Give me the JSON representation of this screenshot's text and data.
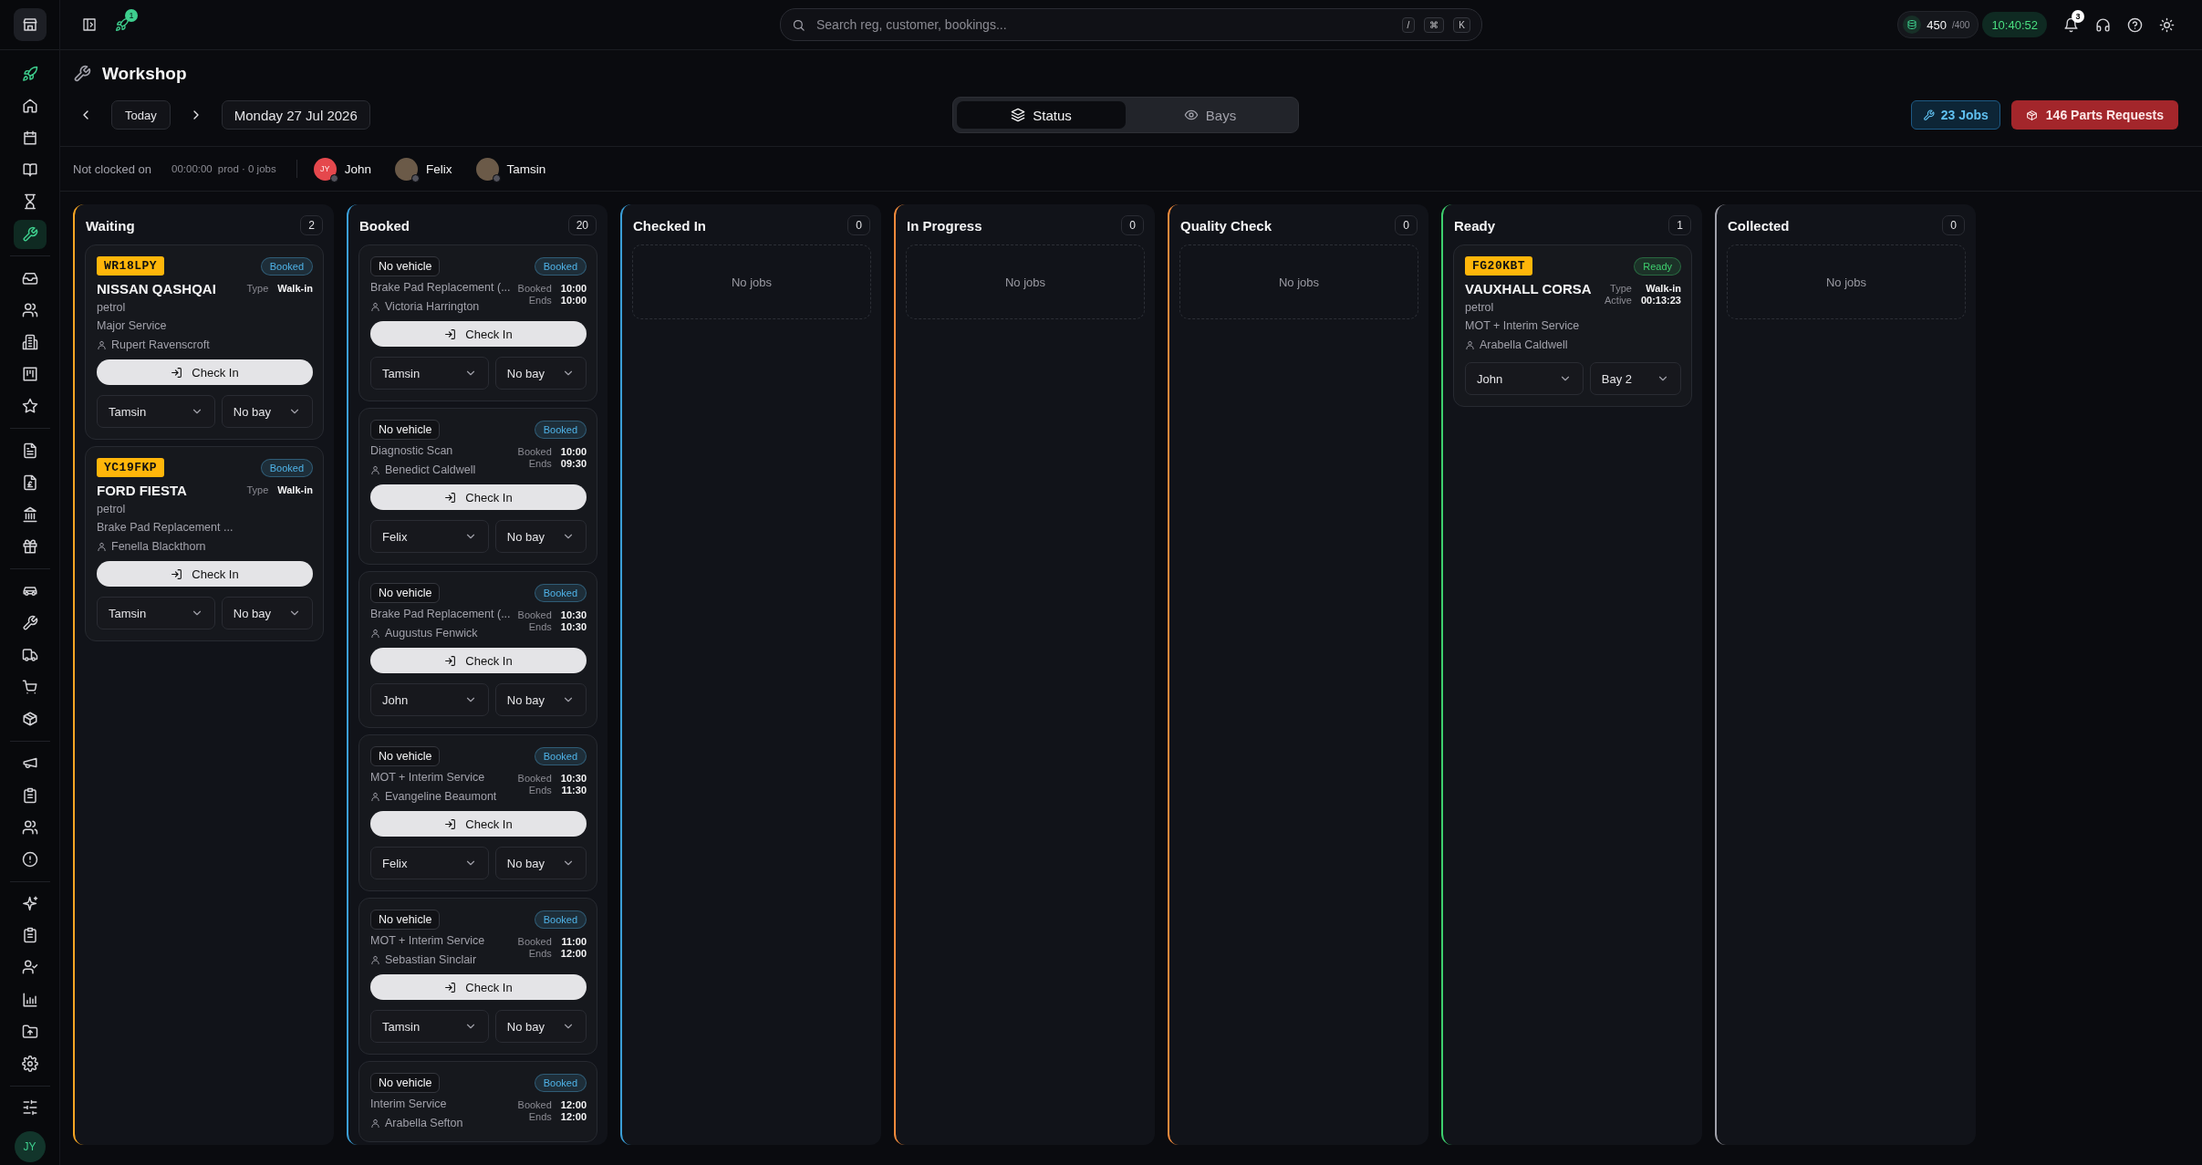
{
  "sidebar": {
    "groups": [
      [
        {
          "selected": false
        },
        {
          "selected": false
        },
        {
          "selected": false
        },
        {
          "selected": false
        },
        {
          "selected": false
        },
        {
          "selected": true
        }
      ],
      [
        {
          "selected": false
        },
        {
          "selected": false
        },
        {
          "selected": false
        },
        {
          "selected": false
        },
        {
          "selected": false
        }
      ],
      [
        {
          "selected": false
        },
        {
          "selected": false
        },
        {
          "selected": false
        },
        {
          "selected": false
        }
      ],
      [
        {
          "selected": false
        },
        {
          "selected": false
        },
        {
          "selected": false
        },
        {
          "selected": false
        },
        {
          "selected": false
        }
      ],
      [
        {
          "selected": false
        },
        {
          "selected": false
        },
        {
          "selected": false
        },
        {
          "selected": false
        }
      ],
      [
        {
          "selected": false
        },
        {
          "selected": false
        },
        {
          "selected": false
        },
        {
          "selected": false
        },
        {
          "selected": false
        },
        {
          "selected": false
        }
      ],
      [
        {
          "selected": false
        }
      ]
    ],
    "user_initials": "JY"
  },
  "top_bar": {
    "launch_badge": "1",
    "search": {
      "placeholder": "Search reg, customer, bookings...",
      "keys": [
        "/",
        "⌘",
        "K"
      ]
    },
    "credits": {
      "value": "450",
      "limit": "/400"
    },
    "clock": "10:40:52",
    "notifications_badge": "3"
  },
  "header": {
    "title": "Workshop",
    "today": "Today",
    "date": "Monday 27 Jul 2026",
    "views": [
      {
        "label": "Status",
        "selected": true
      },
      {
        "label": "Bays",
        "selected": false
      }
    ],
    "jobs_button": "23 Jobs",
    "parts_button": "146 Parts Requests"
  },
  "tech_bar": {
    "status": "Not clocked on",
    "timer": "00:00:00",
    "summary": "prod · 0 jobs",
    "technicians": [
      {
        "name": "John",
        "kind": "initials",
        "initials": "JY"
      },
      {
        "name": "Felix",
        "kind": "picture"
      },
      {
        "name": "Tamsin",
        "kind": "picture"
      }
    ]
  },
  "columns": [
    {
      "title": "Waiting",
      "count": "2",
      "color": "#f5a524",
      "cards": [
        {
          "kind": "plate",
          "tag": "WR18LPY",
          "status": {
            "label": "Booked",
            "color": "#4fb3e8"
          },
          "title": "NISSAN QASHQAI",
          "fuel": "petrol",
          "service": "Major Service",
          "customer": "Rupert Ravenscroft",
          "meta": [
            {
              "label": "Type",
              "value": "Walk-in"
            }
          ],
          "action": "Check In",
          "technician": "Tamsin",
          "bay": "No bay"
        },
        {
          "kind": "plate",
          "tag": "YC19FKP",
          "status": {
            "label": "Booked",
            "color": "#4fb3e8"
          },
          "title": "FORD FIESTA",
          "fuel": "petrol",
          "service": "Brake Pad Replacement ...",
          "customer": "Fenella Blackthorn",
          "meta": [
            {
              "label": "Type",
              "value": "Walk-in"
            }
          ],
          "action": "Check In",
          "technician": "Tamsin",
          "bay": "No bay"
        }
      ]
    },
    {
      "title": "Booked",
      "count": "20",
      "color": "#3b9fd8",
      "cards": [
        {
          "kind": "no-vehicle",
          "tag": "No vehicle",
          "status": {
            "label": "Booked",
            "color": "#4fb3e8"
          },
          "service": "Brake Pad Replacement (...",
          "customer": "Victoria Harrington",
          "meta": [
            {
              "label": "Booked",
              "value": "10:00"
            },
            {
              "label": "Ends",
              "value": "10:00"
            }
          ],
          "action": "Check In",
          "technician": "Tamsin",
          "bay": "No bay"
        },
        {
          "kind": "no-vehicle",
          "tag": "No vehicle",
          "status": {
            "label": "Booked",
            "color": "#4fb3e8"
          },
          "service": "Diagnostic Scan",
          "customer": "Benedict Caldwell",
          "meta": [
            {
              "label": "Booked",
              "value": "10:00"
            },
            {
              "label": "Ends",
              "value": "09:30"
            }
          ],
          "action": "Check In",
          "technician": "Felix",
          "bay": "No bay"
        },
        {
          "kind": "no-vehicle",
          "tag": "No vehicle",
          "status": {
            "label": "Booked",
            "color": "#4fb3e8"
          },
          "service": "Brake Pad Replacement (...",
          "customer": "Augustus Fenwick",
          "meta": [
            {
              "label": "Booked",
              "value": "10:30"
            },
            {
              "label": "Ends",
              "value": "10:30"
            }
          ],
          "action": "Check In",
          "technician": "John",
          "bay": "No bay"
        },
        {
          "kind": "no-vehicle",
          "tag": "No vehicle",
          "status": {
            "label": "Booked",
            "color": "#4fb3e8"
          },
          "service": "MOT + Interim Service",
          "customer": "Evangeline Beaumont",
          "meta": [
            {
              "label": "Booked",
              "value": "10:30"
            },
            {
              "label": "Ends",
              "value": "11:30"
            }
          ],
          "action": "Check In",
          "technician": "Felix",
          "bay": "No bay"
        },
        {
          "kind": "no-vehicle",
          "tag": "No vehicle",
          "status": {
            "label": "Booked",
            "color": "#4fb3e8"
          },
          "service": "MOT + Interim Service",
          "customer": "Sebastian Sinclair",
          "meta": [
            {
              "label": "Booked",
              "value": "11:00"
            },
            {
              "label": "Ends",
              "value": "12:00"
            }
          ],
          "action": "Check In",
          "technician": "Tamsin",
          "bay": "No bay"
        },
        {
          "kind": "no-vehicle",
          "tag": "No vehicle",
          "status": {
            "label": "Booked",
            "color": "#4fb3e8"
          },
          "service": "Interim Service",
          "customer": "Arabella Sefton",
          "meta": [
            {
              "label": "Booked",
              "value": "12:00"
            },
            {
              "label": "Ends",
              "value": "12:00"
            }
          ]
        }
      ]
    },
    {
      "title": "Checked In",
      "count": "0",
      "color": "#3b9fd8",
      "empty_text": "No jobs"
    },
    {
      "title": "In Progress",
      "count": "0",
      "color": "#f08a3c",
      "empty_text": "No jobs"
    },
    {
      "title": "Quality Check",
      "count": "0",
      "color": "#f08a3c",
      "empty_text": "No jobs"
    },
    {
      "title": "Ready",
      "count": "1",
      "color": "#3ecf6e",
      "cards": [
        {
          "kind": "plate",
          "tag": "FG20KBT",
          "status": {
            "label": "Ready",
            "color": "#3ecf6e"
          },
          "title": "VAUXHALL CORSA",
          "fuel": "petrol",
          "service": "MOT + Interim Service",
          "customer": "Arabella Caldwell",
          "meta": [
            {
              "label": "Type",
              "value": "Walk-in"
            },
            {
              "label": "Active",
              "value": "00:13:23"
            }
          ],
          "technician": "John",
          "bay": "Bay 2"
        }
      ]
    },
    {
      "title": "Collected",
      "count": "0",
      "color": "#a1a1aa",
      "empty_text": "No jobs"
    }
  ]
}
